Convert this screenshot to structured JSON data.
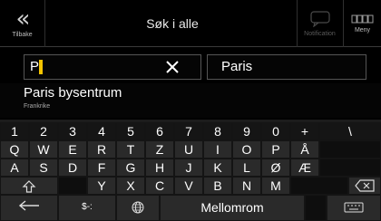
{
  "header": {
    "back_label": "Tilbake",
    "title": "Søk i alle",
    "notification_label": "Notification",
    "menu_label": "Meny"
  },
  "search": {
    "query": "P",
    "location": "Paris"
  },
  "result": {
    "title": "Paris bysentrum",
    "subtitle": "Frankrike"
  },
  "keyboard": {
    "row1": [
      "1",
      "2",
      "3",
      "4",
      "5",
      "6",
      "7",
      "8",
      "9",
      "0",
      "+",
      "\\"
    ],
    "row2": [
      "Q",
      "W",
      "E",
      "R",
      "T",
      "Z",
      "U",
      "I",
      "O",
      "P",
      "Å"
    ],
    "row3": [
      "A",
      "S",
      "D",
      "F",
      "G",
      "H",
      "J",
      "K",
      "L",
      "Ø",
      "Æ"
    ],
    "row4": [
      "Y",
      "X",
      "C",
      "V",
      "B",
      "N",
      "M"
    ],
    "symbols_label": "$-:",
    "space_label": "Mellomrom"
  },
  "colors": {
    "caret": "#f5c400",
    "background": "#000000",
    "key": "#2a2a2a"
  },
  "icons": [
    "back-icon",
    "notification-icon",
    "menu-icon",
    "clear-icon",
    "shift-icon",
    "backspace-icon",
    "arrow-left-icon",
    "globe-icon",
    "keyboard-icon"
  ]
}
